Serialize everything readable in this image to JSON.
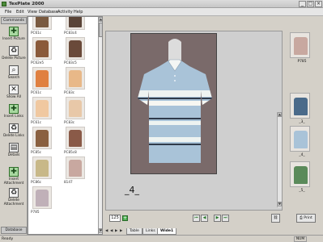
{
  "window": {
    "title": "TexPlate 2000",
    "controls": [
      "_",
      "□",
      "×"
    ]
  },
  "menu": [
    "File",
    "Edit",
    "View",
    "Database",
    "Activity",
    "Help"
  ],
  "commands": {
    "title": "Commands",
    "items": [
      {
        "label": "Insert Picture",
        "icon": "insert-picture-icon",
        "glyph": "✚"
      },
      {
        "label": "Delete Picture",
        "icon": "recycle-bin-icon",
        "glyph": "♻"
      },
      {
        "label": "Search",
        "icon": "search-icon",
        "glyph": "⌕"
      },
      {
        "label": "Show All",
        "icon": "close-x-icon",
        "glyph": "✕"
      },
      {
        "label": "Insert Links",
        "icon": "insert-links-icon",
        "glyph": "✚"
      },
      {
        "label": "Delete Links",
        "icon": "recycle-bin-icon",
        "glyph": "♻"
      },
      {
        "label": "Details",
        "icon": "details-icon",
        "glyph": "▤"
      },
      {
        "label": "Insert Attachment",
        "icon": "insert-attachment-icon",
        "glyph": "✚"
      },
      {
        "label": "Delete Attachment",
        "icon": "recycle-bin-icon",
        "glyph": "♻"
      }
    ],
    "footer": "Database"
  },
  "thumbnails": [
    {
      "caption": "PC61c",
      "color": "#7a5a40"
    },
    {
      "caption": "PC83c4",
      "color": "#5a4438"
    },
    {
      "caption": "",
      "color": ""
    },
    {
      "caption": "PC62e5",
      "color": "#8a5a3a"
    },
    {
      "caption": "PC83c5",
      "color": "#6a4a3a"
    },
    {
      "caption": "",
      "color": ""
    },
    {
      "caption": "PC61c",
      "color": "#e08040"
    },
    {
      "caption": "PC83c",
      "color": "#e8b888"
    },
    {
      "caption": "",
      "color": ""
    },
    {
      "caption": "PC61c",
      "color": "#f0c8a0"
    },
    {
      "caption": "PC83c",
      "color": "#e8c8a8"
    },
    {
      "caption": "",
      "color": ""
    },
    {
      "caption": "PC85c",
      "color": "#8a6040"
    },
    {
      "caption": "PC85c8",
      "color": "#8a5a48"
    },
    {
      "caption": "",
      "color": ""
    },
    {
      "caption": "PC86c",
      "color": "#c8b888"
    },
    {
      "caption": "8147",
      "color": "#c8a8a0"
    },
    {
      "caption": "",
      "color": ""
    },
    {
      "caption": "P785",
      "color": "#c0b0b8"
    }
  ],
  "main": {
    "caption": "_4_",
    "shirt_colors": {
      "base": "#a9c3d8",
      "stripe_light": "#eef3f1",
      "stripe_dark": "#2f3a4a",
      "stripe_white": "#f7f7f2",
      "background": "#7a6a6a"
    }
  },
  "side_thumbs": [
    {
      "caption": "P785",
      "color": "#c8a8a0"
    },
    {
      "caption": "_3_",
      "color": "#4a6a8a"
    },
    {
      "caption": "_4_",
      "color": "#a9c3d8"
    },
    {
      "caption": "_5_",
      "color": "#5a8a5a"
    }
  ],
  "nav": {
    "page": "125",
    "go_glyph": "+",
    "buttons": [
      "⏮",
      "◀",
      "▶",
      "⏭"
    ],
    "link_button": "⛓",
    "print_label": "Print"
  },
  "tabs": [
    "Table",
    "Links",
    "Wide1"
  ],
  "tab_arrows": [
    "◀",
    "◀",
    "▶",
    "▶"
  ],
  "status": {
    "text": "Ready",
    "num": "NUM"
  }
}
